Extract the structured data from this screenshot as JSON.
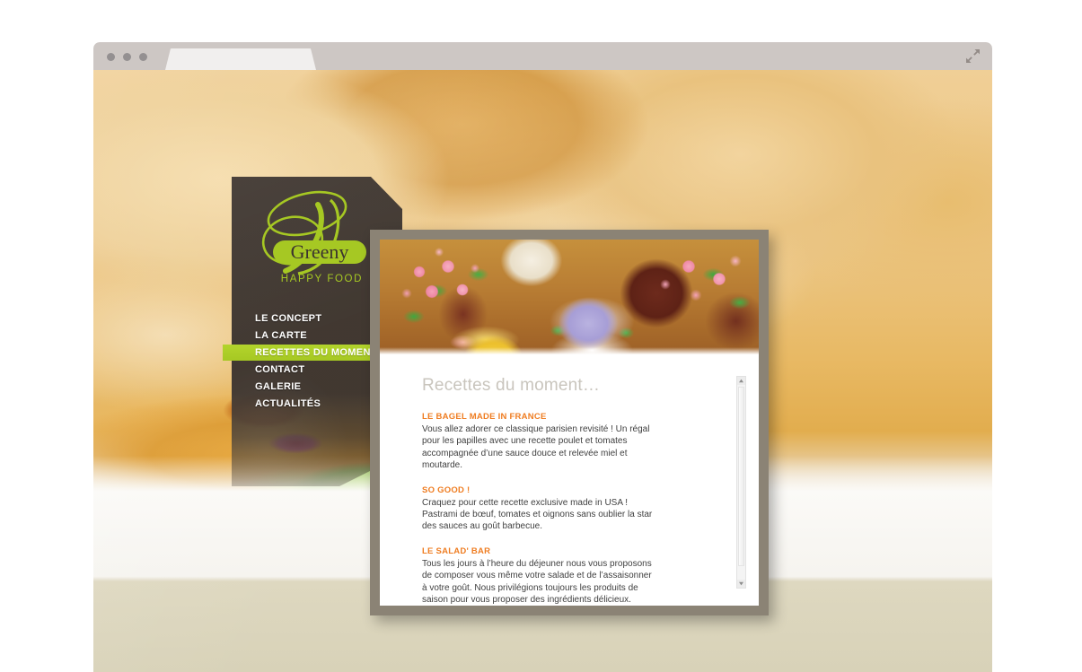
{
  "browser": {
    "traffic_lights": [
      "close",
      "minimize",
      "zoom"
    ],
    "tab_label": "",
    "expand_icon": "expand-arrows-icon",
    "chrome_color": "#cdc7c4",
    "tab_color": "#f1efee"
  },
  "site": {
    "brand": {
      "monogram": "G",
      "name": "Greeny",
      "tagline": "HAPPY FOOD",
      "green": "#a6c823",
      "panel_color": "#3c342f"
    },
    "nav": {
      "items": [
        {
          "label": "LE CONCEPT",
          "active": false
        },
        {
          "label": "LA CARTE",
          "active": false
        },
        {
          "label": "RECETTES DU MOMENT",
          "active": true
        },
        {
          "label": "CONTACT",
          "active": false
        },
        {
          "label": "GALERIE",
          "active": false
        },
        {
          "label": "ACTUALITÉS",
          "active": false
        }
      ],
      "active_color": "#a6c823",
      "text_color": "#ffffff"
    },
    "content": {
      "banner_alt": "cupcakes-photo",
      "frame_color": "#8b8375",
      "title": "Recettes du moment…",
      "title_color": "#c9c5bd",
      "heading_color": "#ef7d22",
      "recipes": [
        {
          "title": "LE BAGEL MADE IN FRANCE",
          "text": "Vous allez adorer ce classique parisien revisité ! Un régal pour les papilles avec une recette poulet et tomates accompagnée d’une sauce douce et relevée miel et moutarde."
        },
        {
          "title": "SO GOOD !",
          "text": "Craquez pour cette recette exclusive made in USA ! Pastrami de bœuf, tomates et oignons sans oublier la star des sauces au goût barbecue."
        },
        {
          "title": "LE SALAD' BAR",
          "text": "Tous les jours à l’heure du déjeuner nous vous proposons de composer vous même votre salade et de l’assaisonner à votre goût. Nous privilégions toujours les produits de saison pour vous proposer des ingrédients délicieux."
        }
      ],
      "scrollbar": {
        "up_arrow": "caret-up-icon",
        "down_arrow": "caret-down-icon"
      }
    },
    "background_alt": "bread-sandwich-photo"
  }
}
